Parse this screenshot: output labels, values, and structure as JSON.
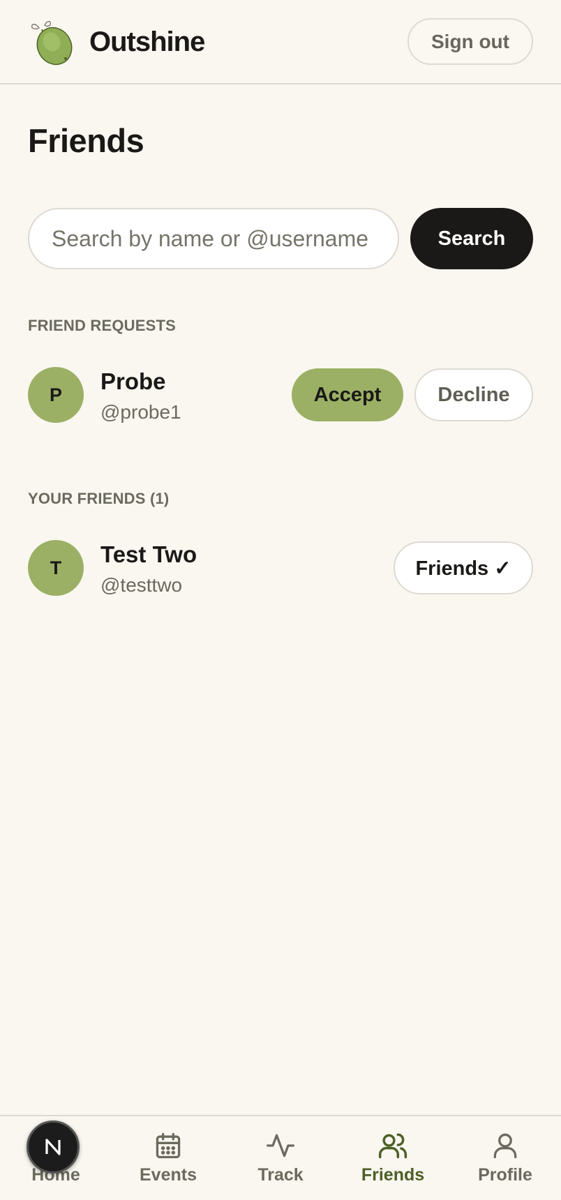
{
  "header": {
    "brand": "Outshine",
    "logo_icon": "lime-fruit-icon",
    "sign_out_label": "Sign out"
  },
  "page": {
    "title": "Friends"
  },
  "search": {
    "placeholder": "Search by name or @username",
    "value": "",
    "button_label": "Search"
  },
  "friend_requests": {
    "heading": "FRIEND REQUESTS",
    "items": [
      {
        "initial": "P",
        "name": "Probe",
        "handle": "@probe1",
        "accept_label": "Accept",
        "decline_label": "Decline"
      }
    ]
  },
  "your_friends": {
    "heading": "YOUR FRIENDS (1)",
    "items": [
      {
        "initial": "T",
        "name": "Test Two",
        "handle": "@testtwo",
        "status_label": "Friends ✓"
      }
    ]
  },
  "nav": {
    "active": "friends",
    "items": [
      {
        "label": "Home",
        "icon": "home-icon"
      },
      {
        "label": "Events",
        "icon": "calendar-icon"
      },
      {
        "label": "Track",
        "icon": "activity-icon"
      },
      {
        "label": "Friends",
        "icon": "users-icon"
      },
      {
        "label": "Profile",
        "icon": "user-icon"
      }
    ]
  },
  "dev_badge": {
    "letter": "N"
  },
  "colors": {
    "background": "#f9f7f0",
    "accent": "#9bb064",
    "dark": "#1a1917",
    "muted": "#6b6a5e",
    "active_nav": "#4e5f26"
  }
}
